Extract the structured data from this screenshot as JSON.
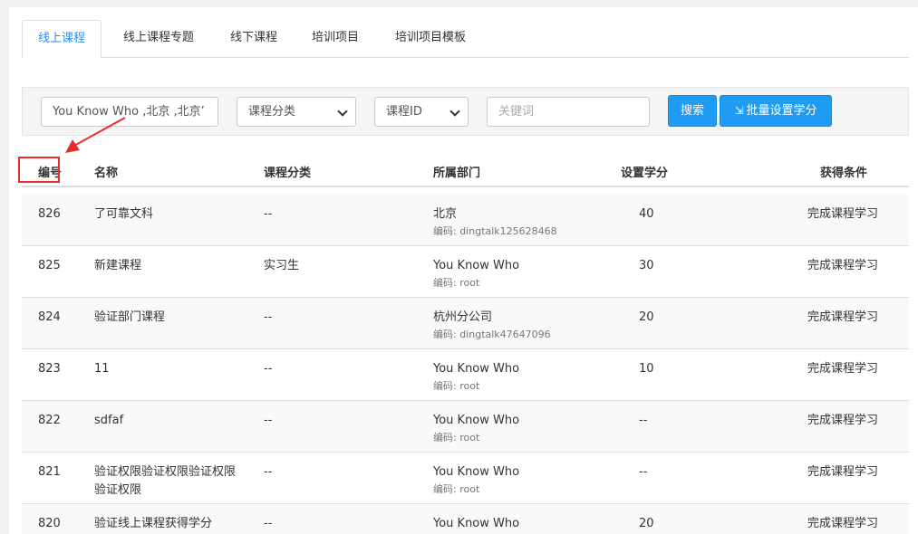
{
  "tabs": [
    {
      "label": "线上课程",
      "active": true
    },
    {
      "label": "线上课程专题"
    },
    {
      "label": "线下课程"
    },
    {
      "label": "培训项目"
    },
    {
      "label": "培训项目模板"
    }
  ],
  "filter": {
    "department_value": "You Know Who ,北京 ,北京’",
    "category_value": "课程分类",
    "id_value": "课程ID",
    "keyword_placeholder": "关键词",
    "search_label": "搜索",
    "batch_label": "批量设置学分",
    "batch_icon": "batch-credit-icon"
  },
  "table": {
    "headers": {
      "id": "编号",
      "name": "名称",
      "category": "课程分类",
      "department": "所属部门",
      "credit": "设置学分",
      "condition": "获得条件"
    },
    "rows": [
      {
        "id": "826",
        "name": "了可靠文科",
        "category": "--",
        "dept": "北京",
        "code": "编码: dingtalk125628468",
        "credit": "40",
        "condition": "完成课程学习"
      },
      {
        "id": "825",
        "name": "新建课程",
        "category": "实习生",
        "dept": "You Know Who",
        "code": "编码: root",
        "credit": "30",
        "condition": "完成课程学习"
      },
      {
        "id": "824",
        "name": "验证部门课程",
        "category": "--",
        "dept": "杭州分公司",
        "code": "编码: dingtalk47647096",
        "credit": "20",
        "condition": "完成课程学习"
      },
      {
        "id": "823",
        "name": "11",
        "category": "--",
        "dept": "You Know Who",
        "code": "编码: root",
        "credit": "10",
        "condition": "完成课程学习"
      },
      {
        "id": "822",
        "name": "sdfaf",
        "category": "--",
        "dept": "You Know Who",
        "code": "编码: root",
        "credit": "--",
        "condition": "完成课程学习"
      },
      {
        "id": "821",
        "name": "验证权限验证权限验证权限\n验证权限",
        "category": "--",
        "dept": "You Know Who",
        "code": "编码: root",
        "credit": "--",
        "condition": "完成课程学习"
      },
      {
        "id": "820",
        "name": "验证线上课程获得学分",
        "category": "--",
        "dept": "You Know Who",
        "code": "",
        "credit": "20",
        "condition": "完成课程学习"
      }
    ]
  },
  "annotation": {
    "color": "#e82c2c"
  }
}
